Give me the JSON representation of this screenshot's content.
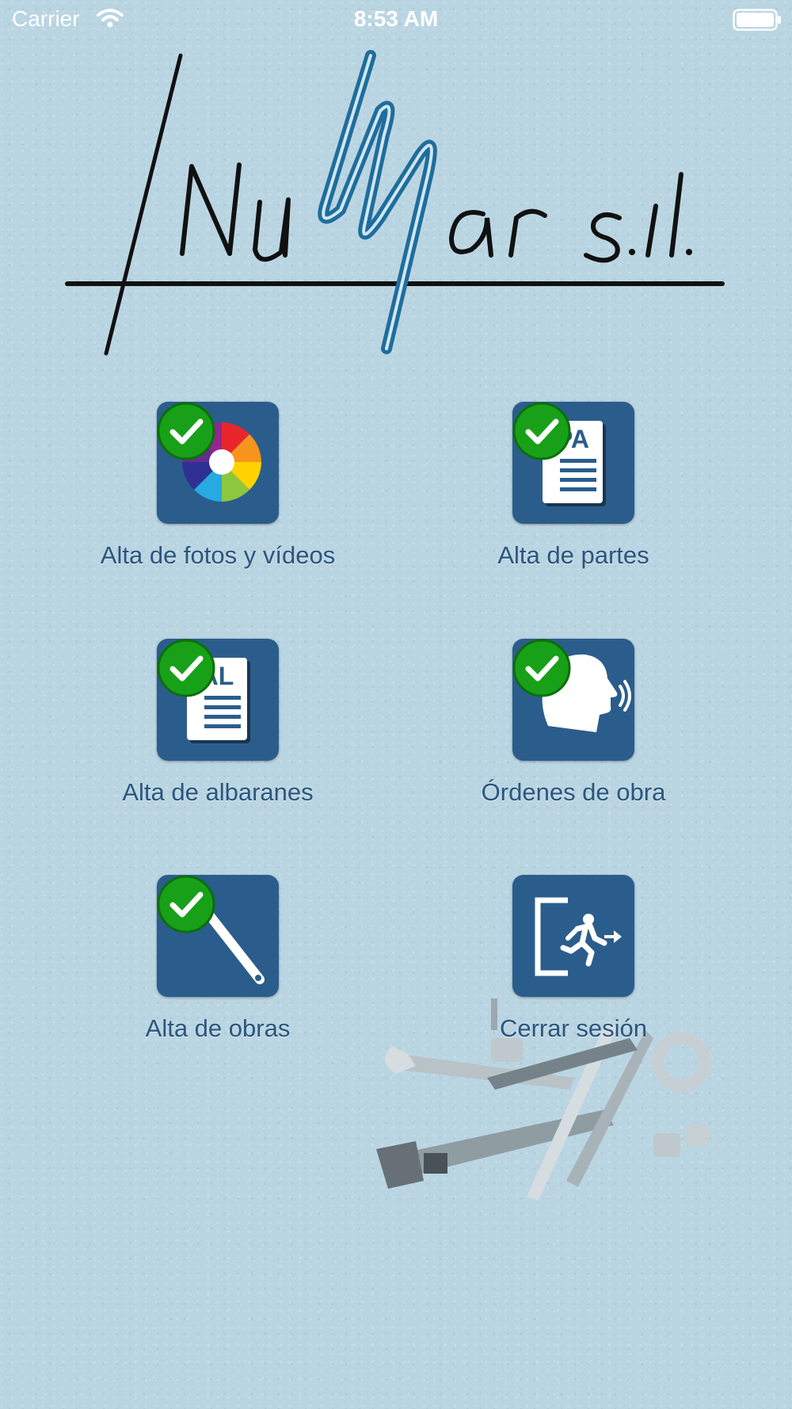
{
  "status_bar": {
    "carrier": "Carrier",
    "time": "8:53 AM"
  },
  "logo": {
    "text_left": "NuMar s.l."
  },
  "menu": {
    "items": [
      {
        "label": "Alta de fotos y vídeos",
        "icon": "camera-aperture-icon",
        "checked": true
      },
      {
        "label": "Alta de partes",
        "icon": "document-pa-icon",
        "checked": true,
        "doc_code": "PA"
      },
      {
        "label": "Alta de albaranes",
        "icon": "document-al-icon",
        "checked": true,
        "doc_code": "AL"
      },
      {
        "label": "Órdenes de obra",
        "icon": "speaking-head-icon",
        "checked": true
      },
      {
        "label": "Alta de obras",
        "icon": "pipe-wrench-icon",
        "checked": true
      },
      {
        "label": "Cerrar sesión",
        "icon": "exit-door-icon",
        "checked": false
      }
    ]
  },
  "colors": {
    "tile": "#2b5d8c",
    "label": "#2b557d",
    "badge": "#1faa1f",
    "background": "#bad5e2"
  }
}
